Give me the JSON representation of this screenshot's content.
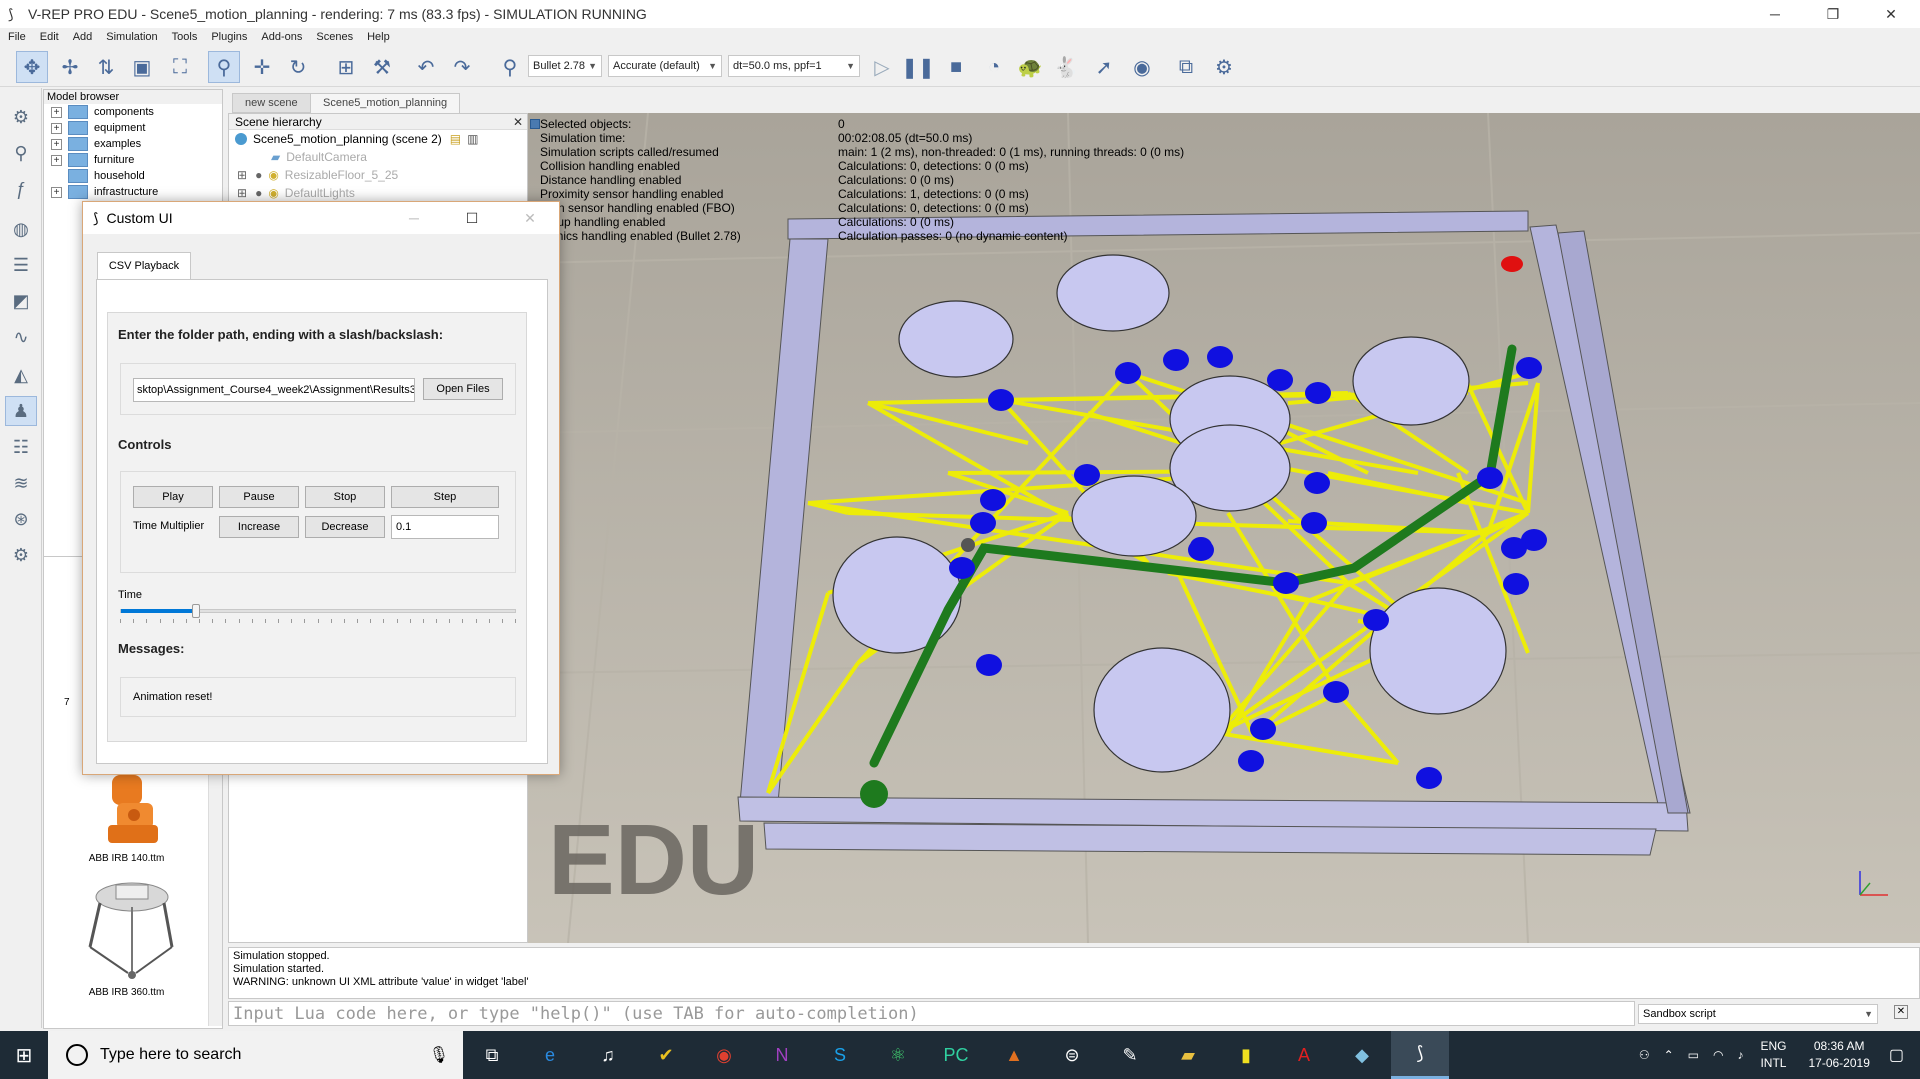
{
  "window": {
    "title": "V-REP PRO EDU - Scene5_motion_planning - rendering: 7 ms (83.3 fps) - SIMULATION RUNNING",
    "minimize": "─",
    "restore": "❐",
    "close": "✕"
  },
  "menu": [
    "File",
    "Edit",
    "Add",
    "Simulation",
    "Tools",
    "Plugins",
    "Add-ons",
    "Scenes",
    "Help"
  ],
  "toolbar": {
    "engine": "Bullet 2.78",
    "accuracy": "Accurate (default)",
    "timestep": "dt=50.0 ms, ppf=1"
  },
  "model_browser": {
    "title": "Model browser",
    "folders": [
      "components",
      "equipment",
      "examples",
      "furniture",
      "household",
      "infrastructure"
    ],
    "models": [
      "ABB IRB 140.ttm",
      "ABB IRB 360.ttm"
    ],
    "partial_label": "7"
  },
  "scene_tabs": [
    "new scene",
    "Scene5_motion_planning"
  ],
  "hierarchy": {
    "title": "Scene hierarchy",
    "close": "✕",
    "root": "Scene5_motion_planning (scene 2)",
    "items": [
      "DefaultCamera",
      "ResizableFloor_5_25",
      "DefaultLights"
    ]
  },
  "info": {
    "labels": [
      "Selected objects:",
      "Simulation time:",
      "Simulation scripts called/resumed",
      "Collision handling enabled",
      "Distance handling enabled",
      "Proximity sensor handling enabled",
      "ision sensor handling enabled (FBO)",
      "group handling enabled",
      "namics handling enabled (Bullet 2.78)"
    ],
    "values": [
      "0",
      "00:02:08.05 (dt=50.0 ms)",
      "main: 1 (2 ms), non-threaded: 0 (1 ms), running threads: 0 (0 ms)",
      "Calculations: 0, detections: 0 (0 ms)",
      "Calculations: 0 (0 ms)",
      "Calculations: 1, detections: 0 (0 ms)",
      "Calculations: 0, detections: 0 (0 ms)",
      "Calculations: 0 (0 ms)",
      "Calculation passes: 0 (no dynamic content)"
    ],
    "watermark": "EDU"
  },
  "console": {
    "lines": [
      "Simulation stopped.",
      "Simulation started.",
      "WARNING: unknown UI XML attribute 'value' in widget 'label'"
    ],
    "input_placeholder": "Input Lua code here, or type \"help()\" (use TAB for auto-completion)",
    "script_select": "Sandbox script"
  },
  "dialog": {
    "title": "Custom UI",
    "tab": "CSV Playback",
    "folder_prompt": "Enter the folder path, ending with a slash/backslash:",
    "path_value": "sktop\\Assignment_Course4_week2\\Assignment\\Results3\\",
    "open_files": "Open Files",
    "controls_label": "Controls",
    "play": "Play",
    "pause": "Pause",
    "stop": "Stop",
    "step": "Step",
    "time_multiplier_label": "Time Multiplier",
    "increase": "Increase",
    "decrease": "Decrease",
    "multiplier_value": "0.1",
    "time_label": "Time",
    "time_progress_percent": 19,
    "messages_label": "Messages:",
    "message": "Animation reset!"
  },
  "taskbar": {
    "search_placeholder": "Type here to search",
    "lang_top": "ENG",
    "lang_bottom": "INTL",
    "time": "08:36 AM",
    "date": "17-06-2019"
  },
  "colors": {
    "path_green": "#1e7a1e",
    "edges_yellow": "#f0f000",
    "nodes_blue": "#1010e0",
    "goal_red": "#e01010",
    "obstacle": "#c8c8f0",
    "wall": "#b4b4dc"
  }
}
